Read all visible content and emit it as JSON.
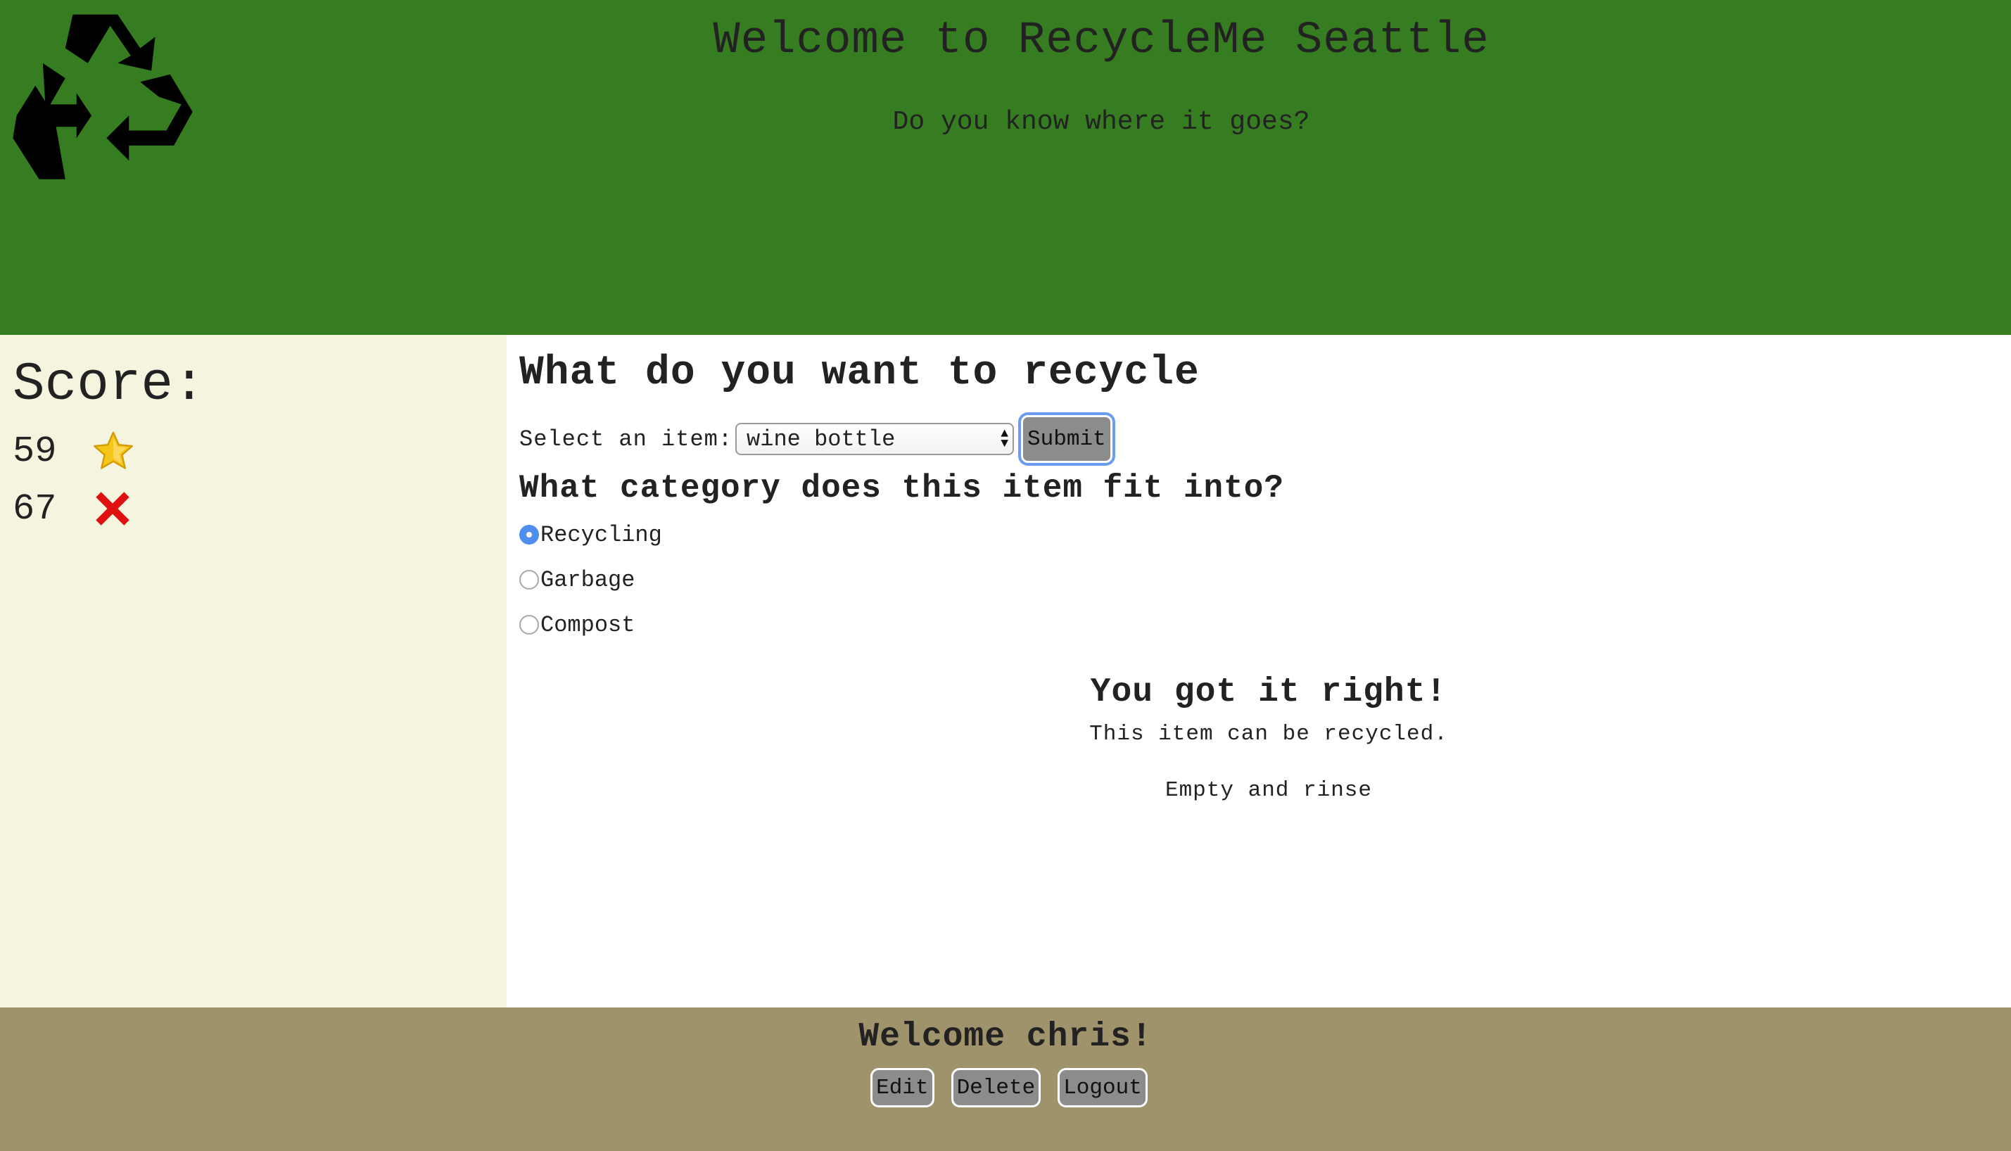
{
  "header": {
    "title": "Welcome to RecycleMe Seattle",
    "subtitle": "Do you know where it goes?",
    "logo_icon": "recycle-icon"
  },
  "sidebar": {
    "score_heading": "Score:",
    "correct_count": "59",
    "correct_icon": "star-icon",
    "wrong_count": "67",
    "wrong_icon": "x-icon"
  },
  "main": {
    "heading": "What do you want to recycle",
    "select_label": "Select an item:",
    "selected_item": "wine bottle",
    "submit_label": "Submit",
    "category_heading": "What category does this item fit into?",
    "categories": [
      {
        "label": "Recycling",
        "checked": true
      },
      {
        "label": "Garbage",
        "checked": false
      },
      {
        "label": "Compost",
        "checked": false
      }
    ]
  },
  "result": {
    "heading": "You got it right!",
    "line1": "This item can be recycled.",
    "line2": "Empty and rinse"
  },
  "footer": {
    "welcome": "Welcome chris!",
    "edit_label": "Edit",
    "delete_label": "Delete",
    "logout_label": "Logout"
  },
  "colors": {
    "header_bg": "#367c21",
    "sidebar_bg": "#f5f4de",
    "footer_bg": "#9e936a",
    "button_bg": "#8c8c8c",
    "radio_accent": "#4e8ff0",
    "x_red": "#e01010",
    "star_gold": "#f5c518"
  }
}
